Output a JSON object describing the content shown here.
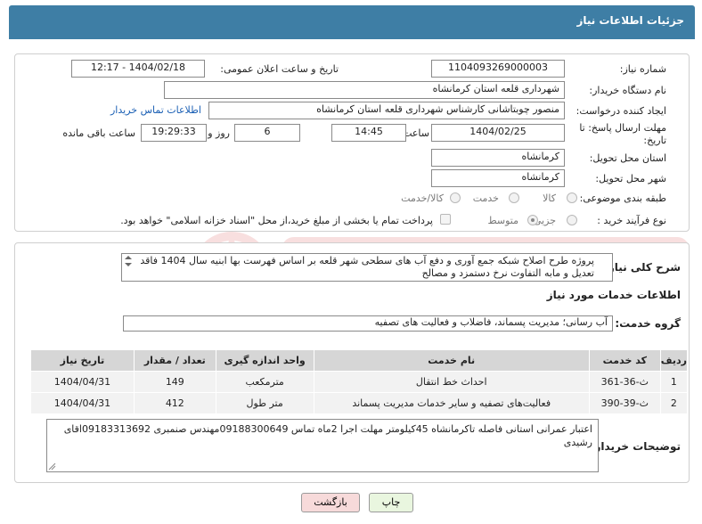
{
  "header": {
    "title": "جزئیات اطلاعات نیاز"
  },
  "fields": {
    "need_number_label": "شماره نیاز:",
    "need_number": "1104093269000003",
    "announce_label": "تاریخ و ساعت اعلان عمومی:",
    "announce_value": "1404/02/18 - 12:17",
    "buyer_org_label": "نام دستگاه خریدار:",
    "buyer_org": "شهرداری قلعه استان کرمانشاه",
    "creator_label": "ایجاد کننده درخواست:",
    "creator": "منصور چوبتاشانی کارشناس شهرداری قلعه استان کرمانشاه",
    "contact_link": "اطلاعات تماس خریدار",
    "deadline_label_1": "مهلت ارسال پاسخ: تا",
    "deadline_label_2": "تاریخ:",
    "deadline_date": "1404/02/25",
    "time_label": "ساعت",
    "deadline_time": "14:45",
    "days_value": "6",
    "days_label": "روز و",
    "remaining_time": "19:29:33",
    "remaining_label": "ساعت باقی مانده",
    "province_label": "استان محل تحویل:",
    "province": "کرمانشاه",
    "city_label": "شهر محل تحویل:",
    "city": "کرمانشاه",
    "category_label": "طبقه بندی موضوعی:",
    "category_options": [
      "کالا",
      "خدمت",
      "کالا/خدمت"
    ],
    "process_label": "نوع فرآیند خرید :",
    "process_options": [
      "جزیی",
      "متوسط"
    ],
    "payment_note": "پرداخت تمام یا بخشی از مبلغ خرید،از محل \"اسناد خزانه اسلامی\" خواهد بود."
  },
  "description": {
    "label": "شرح کلی نیاز:",
    "text": "پروژه طرح اصلاح شبکه جمع آوری و دفع آب های سطحی شهر قلعه بر اساس فهرست بها ابنیه سال 1404 فاقد تعدیل و مابه التفاوت نرخ دستمزد و مصالح"
  },
  "services": {
    "section_title": "اطلاعات خدمات مورد نیاز",
    "group_label": "گروه خدمت:",
    "group_value": "آب رسانی؛ مدیریت پسماند، فاضلاب و فعالیت های تصفیه",
    "columns": [
      "ردیف",
      "کد خدمت",
      "نام خدمت",
      "واحد اندازه گیری",
      "تعداد / مقدار",
      "تاریخ نیاز"
    ],
    "rows": [
      [
        "1",
        "ث-36-361",
        "احداث خط انتقال",
        "مترمکعب",
        "149",
        "1404/04/31"
      ],
      [
        "2",
        "ث-39-390",
        "فعالیت‌های تصفیه و سایر خدمات مدیریت پسماند",
        "متر طول",
        "412",
        "1404/04/31"
      ]
    ]
  },
  "buyer_notes": {
    "label": "توضیحات خریدار:",
    "text": "اعتبار عمرانی استانی فاصله تاکرمانشاه 45کیلومتر مهلت اجرا 2ماه تماس 09188300649مهندس صنمبری 09183313692اقای رشیدی"
  },
  "buttons": {
    "print": "چاپ",
    "back": "بازگشت"
  },
  "colors": {
    "header_bg": "#3e7ea5",
    "back_btn_bg": "#f7dada",
    "print_btn_bg": "#e9f6df"
  }
}
